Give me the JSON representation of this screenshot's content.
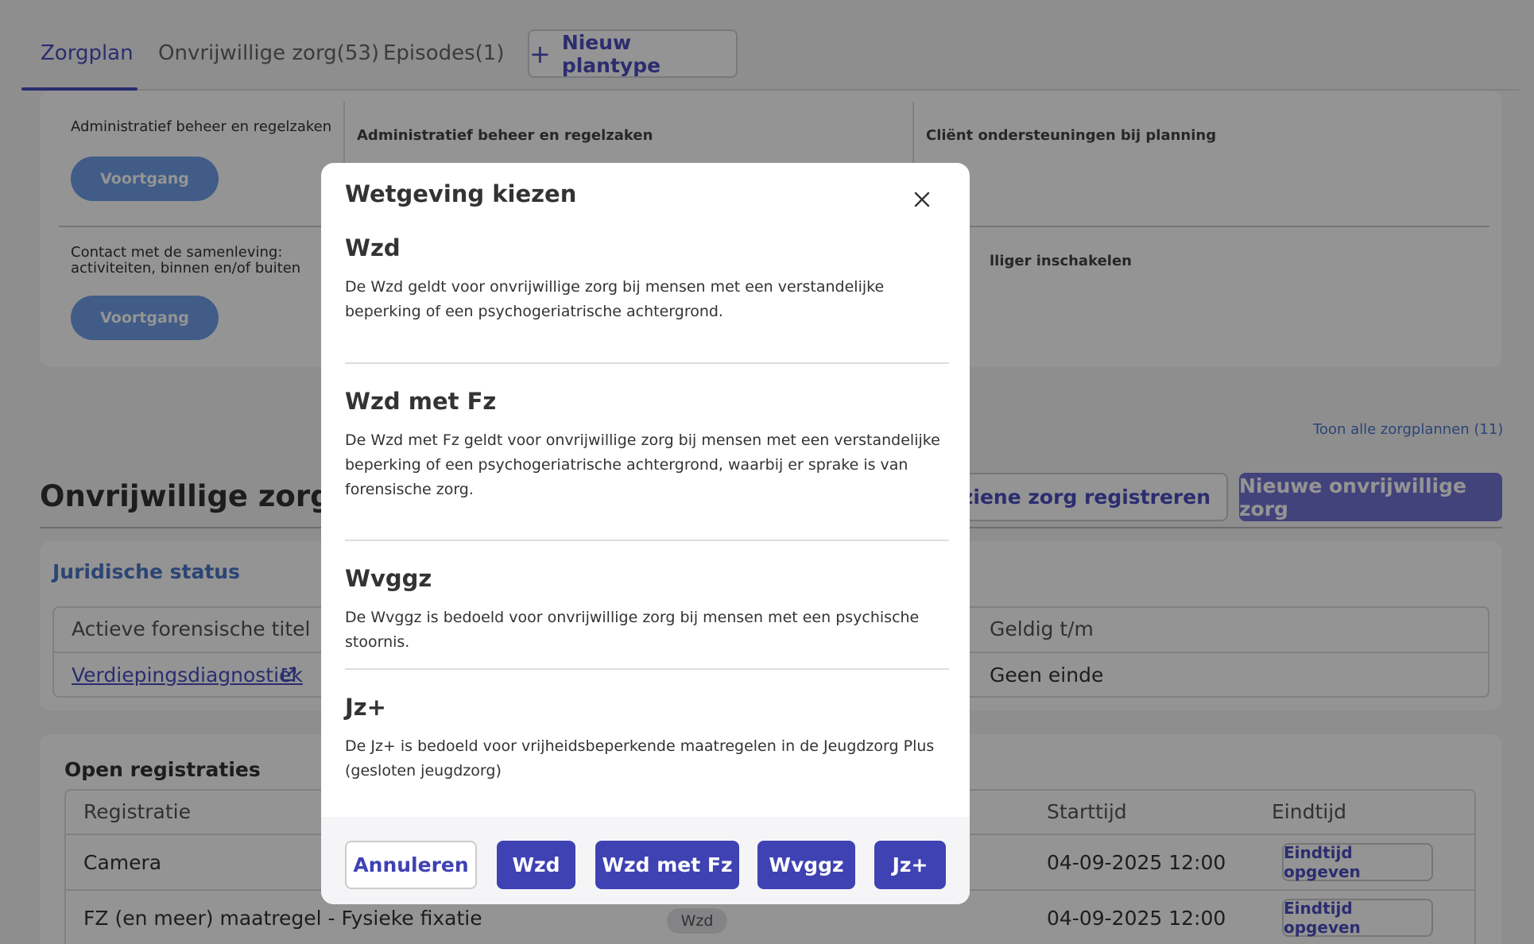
{
  "tabs": {
    "items": [
      {
        "label": "Zorgplan"
      },
      {
        "label": "Onvrijwillige zorg(53)"
      },
      {
        "label": "Episodes(1)"
      }
    ],
    "new_plan_label": "Nieuw plantype"
  },
  "care_plans": {
    "left_items": [
      {
        "text": "Administratief beheer en regelzaken",
        "button": "Voortgang"
      },
      {
        "text": "Contact met de samenleving: activiteiten, binnen en/of buiten",
        "button": "Voortgang"
      }
    ],
    "headers": [
      "Administratief beheer en regelzaken",
      "Cliënt ondersteuningen bij planning",
      "lliger inschakelen"
    ],
    "show_all": "Toon alle zorgplannen (11)"
  },
  "involuntary": {
    "title": "Onvrijwillige zorg",
    "register_label": "nvoorziene zorg registreren",
    "new_label": "Nieuwe onvrijwillige zorg"
  },
  "legal_status": {
    "title": "Juridische status",
    "columns": [
      "Actieve forensische titel",
      "Geldig t/m"
    ],
    "row": {
      "title": "Verdiepingsdiagnostiek",
      "valid_until": "Geen einde"
    }
  },
  "open_registrations": {
    "title": "Open registraties",
    "columns": {
      "registration": "Registratie",
      "start": "Starttijd",
      "end": "Eindtijd"
    },
    "rows": [
      {
        "name": "Camera",
        "badge": "",
        "start": "04-09-2025 12:00",
        "end_button": "Eindtijd opgeven"
      },
      {
        "name": "FZ (en meer) maatregel - Fysieke fixatie",
        "badge": "Wzd",
        "start": "04-09-2025 12:00",
        "end_button": "Eindtijd opgeven"
      }
    ]
  },
  "modal": {
    "title": "Wetgeving kiezen",
    "options": [
      {
        "title": "Wzd",
        "description": "De Wzd geldt voor onvrijwillige zorg bij mensen met een verstandelijke beperking of een psychogeriatrische achtergrond."
      },
      {
        "title": "Wzd met Fz",
        "description": "De Wzd met Fz geldt voor onvrijwillige zorg bij mensen met een verstandelijke beperking of een psychogeriatrische achtergrond, waarbij er sprake is van forensische zorg."
      },
      {
        "title": "Wvggz",
        "description": "De Wvggz is bedoeld voor onvrijwillige zorg bij mensen met een psychische stoornis."
      },
      {
        "title": "Jz+",
        "description": "De Jz+ is bedoeld voor vrijheidsbeperkende maatregelen in de Jeugdzorg Plus (gesloten jeugdzorg)"
      }
    ],
    "buttons": {
      "cancel": "Annuleren",
      "wzd": "Wzd",
      "wzd_fz": "Wzd met Fz",
      "wvggz": "Wvggz",
      "jz": "Jz+"
    }
  },
  "colors": {
    "primary": "#3f42b3",
    "link": "#4a78c8",
    "progress": "#6f9fe8"
  }
}
